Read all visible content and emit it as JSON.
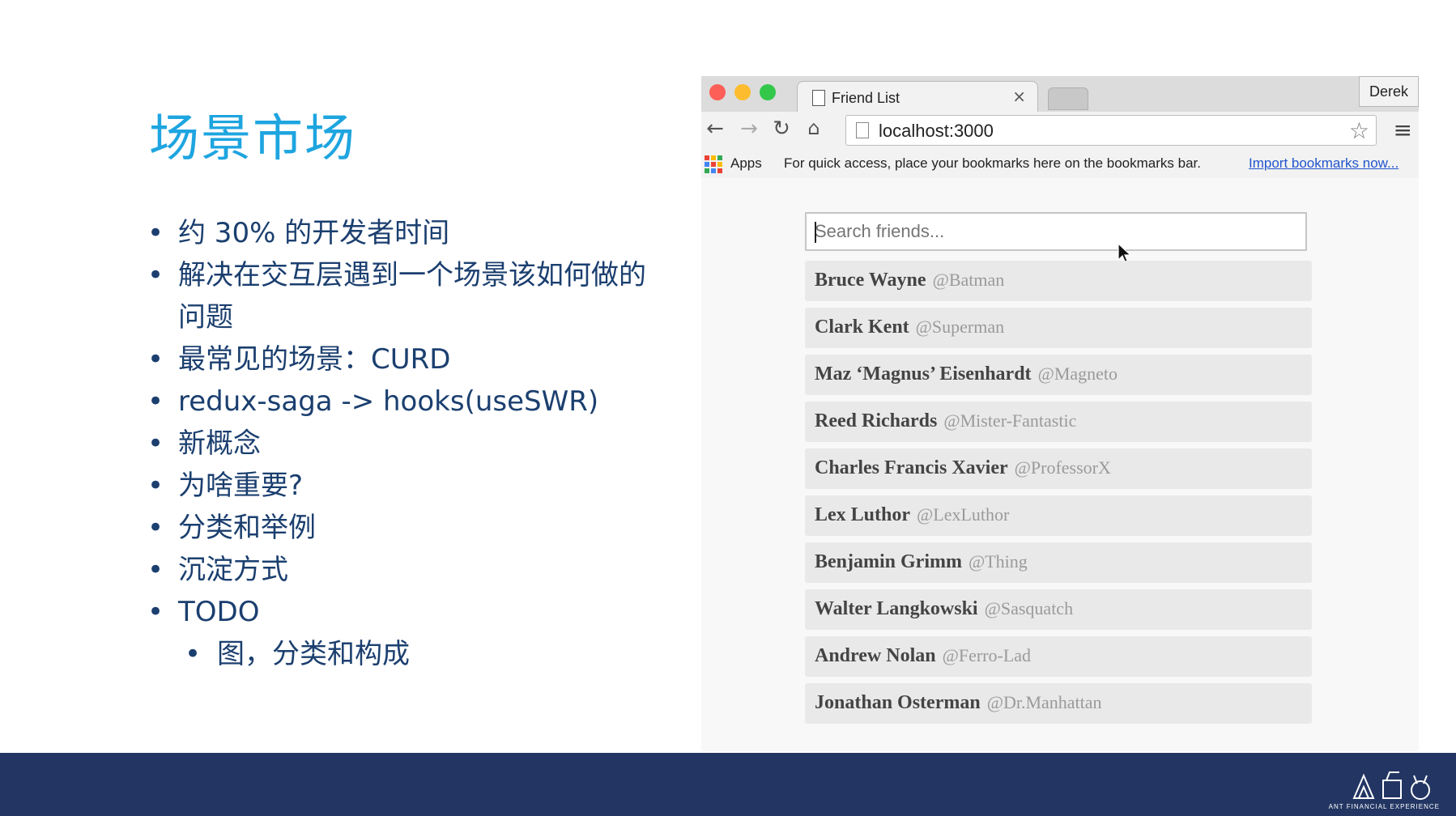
{
  "slide": {
    "title": "场景市场",
    "bullets": [
      "约 30% 的开发者时间",
      "解决在交互层遇到一个场景该如何做的问题",
      "最常见的场景：CURD",
      "redux-saga -> hooks(useSWR)",
      "新概念",
      "为啥重要?",
      "分类和举例",
      "沉淀方式",
      "TODO"
    ],
    "sub_bullets": [
      "图，分类和构成"
    ]
  },
  "browser": {
    "tab_title": "Friend List",
    "tab_close": "×",
    "profile_name": "Derek",
    "url": "localhost:3000",
    "bookmarks": {
      "apps_label": "Apps",
      "hint": "For quick access, place your bookmarks here on the bookmarks bar.",
      "import_link": "Import bookmarks now..."
    },
    "traffic_colors": [
      "#fc5f57",
      "#fdbc2e",
      "#34c84a"
    ]
  },
  "app": {
    "search_placeholder": "Search friends...",
    "friends": [
      {
        "name": "Bruce Wayne",
        "handle": "@Batman"
      },
      {
        "name": "Clark Kent",
        "handle": "@Superman"
      },
      {
        "name": "Maz ‘Magnus’ Eisenhardt",
        "handle": "@Magneto"
      },
      {
        "name": "Reed Richards",
        "handle": "@Mister-Fantastic"
      },
      {
        "name": "Charles Francis Xavier",
        "handle": "@ProfessorX"
      },
      {
        "name": "Lex Luthor",
        "handle": "@LexLuthor"
      },
      {
        "name": "Benjamin Grimm",
        "handle": "@Thing"
      },
      {
        "name": "Walter Langkowski",
        "handle": "@Sasquatch"
      },
      {
        "name": "Andrew Nolan",
        "handle": "@Ferro-Lad"
      },
      {
        "name": "Jonathan Osterman",
        "handle": "@Dr.Manhattan"
      }
    ]
  },
  "footer": {
    "brand_text": "ANT FINANCIAL EXPERIENCE",
    "background": "#233663"
  },
  "icons": {
    "back": "back-arrow-icon",
    "forward": "forward-arrow-icon",
    "reload": "reload-icon",
    "home": "home-icon",
    "star": "star-icon",
    "menu": "hamburger-menu-icon"
  }
}
